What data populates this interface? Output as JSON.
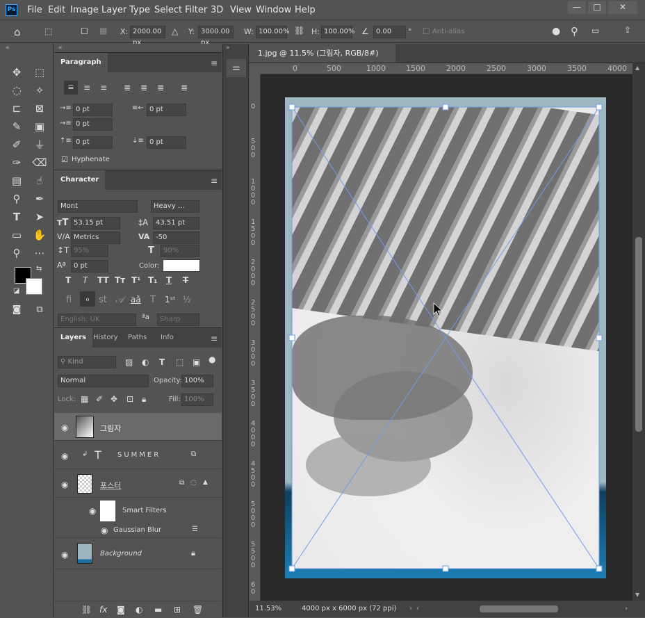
{
  "app": {
    "logo": "Ps",
    "menus": [
      "File",
      "Edit",
      "Image",
      "Layer",
      "Type",
      "Select",
      "Filter",
      "3D",
      "View",
      "Window",
      "Help"
    ],
    "window_controls": [
      "—",
      "□",
      "✕"
    ]
  },
  "options": {
    "x_label": "X:",
    "x_value": "2000.00 px",
    "y_label": "Y:",
    "y_value": "3000.00 px",
    "w_label": "W:",
    "w_value": "100.00%",
    "h_label": "H:",
    "h_value": "100.00%",
    "angle_value": "0.00",
    "angle_unit": "°",
    "antialias": "Anti-alias"
  },
  "paragraph": {
    "tab": "Paragraph",
    "indent_left": "0 pt",
    "indent_right": "0 pt",
    "indent_first": "0 pt",
    "space_before": "0 pt",
    "space_after": "0 pt",
    "hyphenate": "Hyphenate"
  },
  "character": {
    "tab": "Character",
    "font": "Mont",
    "style": "Heavy ...",
    "size": "53.15 pt",
    "leading": "43.51 pt",
    "kerning": "Metrics",
    "tracking": "-50",
    "vscale": "95%",
    "hscale": "90%",
    "baseline": "0 pt",
    "color_label": "Color:",
    "language": "English: UK",
    "aa_label": "ªa",
    "antialias": "Sharp",
    "color": "#ffffff"
  },
  "layers": {
    "tabs": [
      "Layers",
      "History",
      "Paths",
      "Info"
    ],
    "filter_kind": "Kind",
    "blend": "Normal",
    "opacity_label": "Opacity:",
    "opacity": "100%",
    "lock_label": "Lock:",
    "fill_label": "Fill:",
    "fill": "100%",
    "items": [
      {
        "name": "그림자"
      },
      {
        "name": "SUMMER"
      },
      {
        "name": "포스터"
      },
      {
        "name": "Smart Filters"
      },
      {
        "name": "Gaussian Blur"
      },
      {
        "name": "Background"
      }
    ]
  },
  "document": {
    "tab_title": "1.jpg @ 11.5% (그림자, RGB/8#) *",
    "zoom": "11.53%",
    "dims": "4000 px x 6000 px (72 ppi)",
    "ruler_h": [
      "0",
      "500",
      "1000",
      "1500",
      "2000",
      "2500",
      "3000",
      "3500",
      "4000"
    ],
    "ruler_v": [
      "0",
      "5 0 0",
      "1 0 0 0",
      "1 5 0 0",
      "2 0 0 0",
      "2 5 0 0",
      "3 0 0 0",
      "3 5 0 0",
      "4 0 0 0",
      "4 5 0 0",
      "5 0 0 0",
      "5 5 0 0",
      "6 0"
    ]
  }
}
